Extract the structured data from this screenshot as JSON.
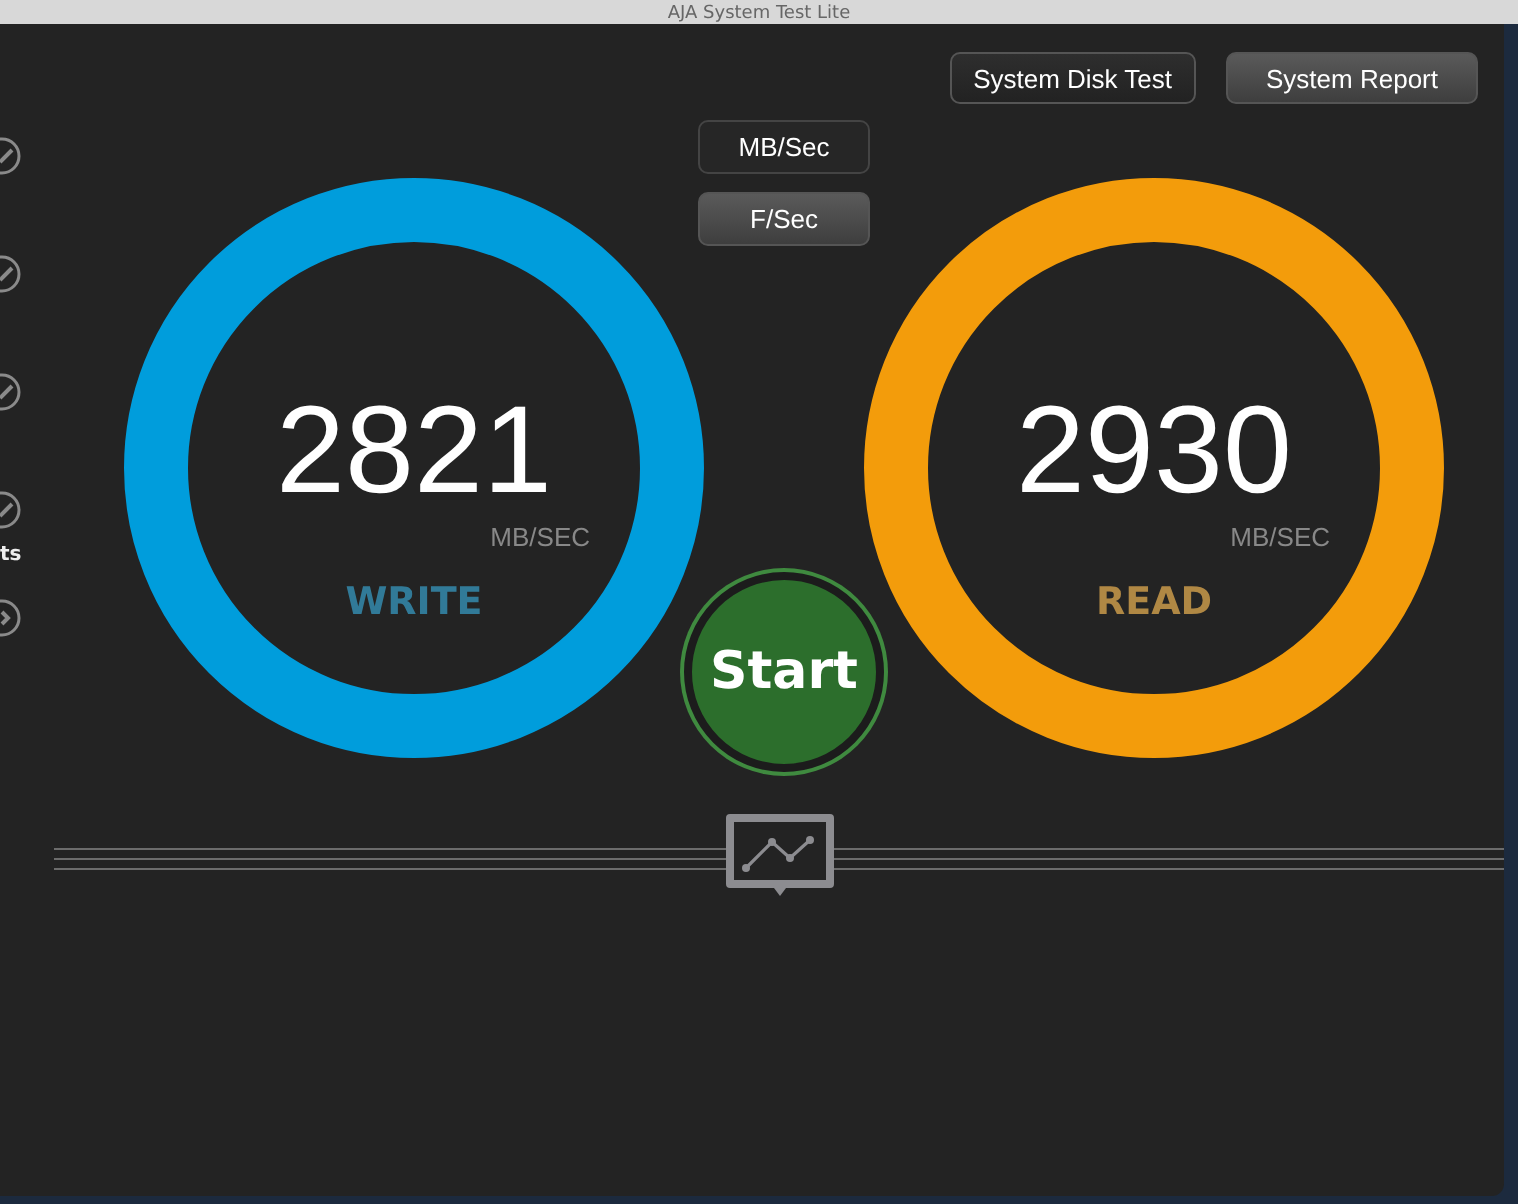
{
  "window": {
    "title": "AJA System Test Lite"
  },
  "sidebar": {
    "items": [
      {
        "kind": "check"
      },
      {
        "kind": "check"
      },
      {
        "kind": "check"
      },
      {
        "kind": "check",
        "label": "ts"
      },
      {
        "kind": "arrow"
      }
    ]
  },
  "top_buttons": [
    "System Disk Test",
    "System Report"
  ],
  "units": [
    {
      "label": "MB/Sec",
      "selected": true
    },
    {
      "label": "F/Sec",
      "selected": false
    }
  ],
  "gauges": [
    {
      "value": "2821",
      "unit": "MB/SEC",
      "label": "WRITE",
      "color": "#009ddc"
    },
    {
      "value": "2930",
      "unit": "MB/SEC",
      "label": "READ",
      "color": "#f39c0b"
    }
  ],
  "start_button": "Start"
}
